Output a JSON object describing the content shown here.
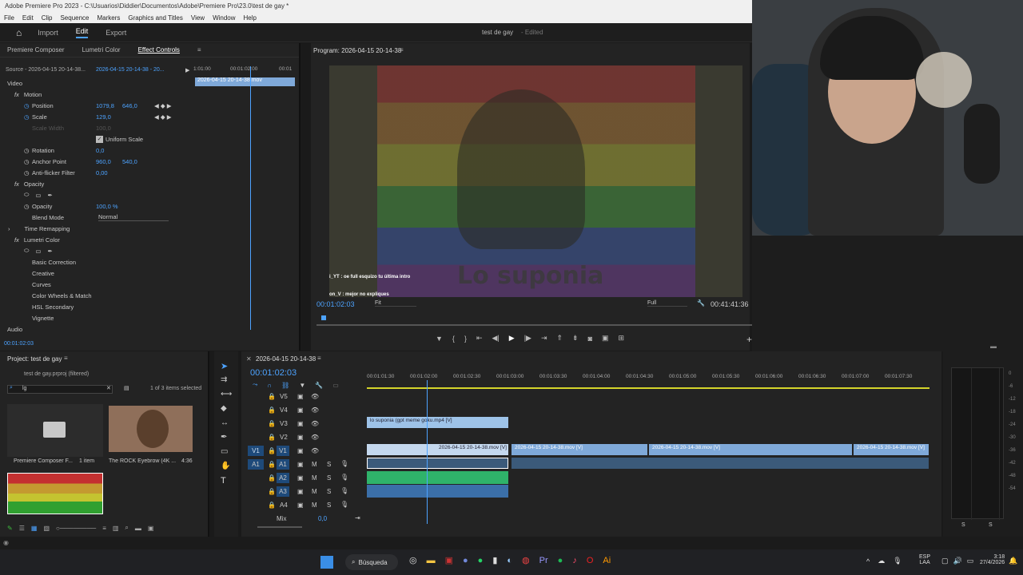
{
  "window": {
    "title": "Adobe Premiere Pro 2023 - C:\\Usuarios\\Diddier\\Documentos\\Adobe\\Premiere Pro\\23.0\\test de gay *"
  },
  "menu": [
    "File",
    "Edit",
    "Clip",
    "Sequence",
    "Markers",
    "Graphics and Titles",
    "View",
    "Window",
    "Help"
  ],
  "workspace": {
    "tabs": [
      "Import",
      "Edit",
      "Export"
    ],
    "active": "Edit",
    "project_title": "test de gay",
    "edited": "- Edited"
  },
  "effect_panel": {
    "tabs": [
      "Premiere Composer",
      "Lumetri Color",
      "Effect Controls"
    ],
    "source": "Source - 2026-04-15 20-14-38...",
    "clip": "2026-04-15 20-14-38 - 20...",
    "ruler": [
      "1:01:00",
      "00:01:02:00",
      "00:01"
    ],
    "clip_bar": "2026-04-15 20-14-38.mov",
    "video_label": "Video",
    "motion": "Motion",
    "position_label": "Position",
    "position_x": "1079,8",
    "position_y": "646,0",
    "scale_label": "Scale",
    "scale_value": "129,0",
    "scale_width_label": "Scale Width",
    "scale_width_value": "100,0",
    "uniform_scale": "Uniform Scale",
    "rotation_label": "Rotation",
    "rotation_value": "0,0",
    "anchor_label": "Anchor Point",
    "anchor_x": "960,0",
    "anchor_y": "540,0",
    "flicker_label": "Anti-flicker Filter",
    "flicker_value": "0,00",
    "opacity_group": "Opacity",
    "opacity_label": "Opacity",
    "opacity_value": "100,0 %",
    "blend_label": "Blend Mode",
    "blend_value": "Normal",
    "time_remap": "Time Remapping",
    "lumetri": "Lumetri Color",
    "lumetri_items": [
      "Basic Correction",
      "Creative",
      "Curves",
      "Color Wheels & Match",
      "HSL Secondary",
      "Vignette"
    ],
    "audio_label": "Audio",
    "timecode": "00:01:02:03"
  },
  "program": {
    "title": "Program: 2026-04-15 20-14-38",
    "caption_overlay": "Lo suponia",
    "chat1": "i_YT : oe full esquizo tu última intro",
    "chat2": "on_V : mejor no expliques",
    "timecode": "00:01:02:03",
    "fit": "Fit",
    "quality": "Full",
    "duration": "00:41:41:36"
  },
  "project": {
    "title": "Project: test de gay",
    "file": "test de gay.prproj (filtered)",
    "search": "lg",
    "selected": "1 of 3 items selected",
    "items": [
      {
        "name": "Premiere Composer F...",
        "meta": "1 item"
      },
      {
        "name": "The ROCK Eyebrow (4K ...",
        "meta": "4:36"
      }
    ]
  },
  "timeline": {
    "tab": "2026-04-15 20-14-38",
    "timecode": "00:01:02:03",
    "ruler": [
      "00:01:01:30",
      "00:01:02:00",
      "00:01:02:30",
      "00:01:03:00",
      "00:01:03:30",
      "00:01:04:00",
      "00:01:04:30",
      "00:01:05:00",
      "00:01:05:30",
      "00:01:06:00",
      "00:01:06:30",
      "00:01:07:00",
      "00:01:07:30"
    ],
    "video_tracks": [
      "V5",
      "V4",
      "V3",
      "V2",
      "V1"
    ],
    "audio_tracks": [
      "A1",
      "A2",
      "A3",
      "A4"
    ],
    "mix_label": "Mix",
    "mix_value": "0,0",
    "v3_clip": "lo suponia (gpt meme goku.mp4 [V]",
    "v1_clips": [
      "2026-04-15 20-14-38.mov [V]",
      "2026-04-15 20-14-38.mov [V]",
      "2026-04-15 20-14-38.mov [V]",
      "2026-04-15 20-14-38.mov [V]"
    ],
    "src_v1": "V1",
    "src_a1": "A1"
  },
  "meters": {
    "scale": [
      "0",
      "-6",
      "-12",
      "-18",
      "-24",
      "-30",
      "-36",
      "-42",
      "-48",
      "-54"
    ],
    "solo": [
      "S",
      "S"
    ]
  },
  "taskbar": {
    "search": "Búsqueda",
    "lang": "ESP",
    "region": "LAA",
    "time": "3:18",
    "date": "27/4/2026"
  },
  "colors": {
    "accent": "#4da3ff",
    "clip_video": "#9ec3e8",
    "clip_audio": "#2fb36a",
    "playhead": "#4da3ff"
  }
}
